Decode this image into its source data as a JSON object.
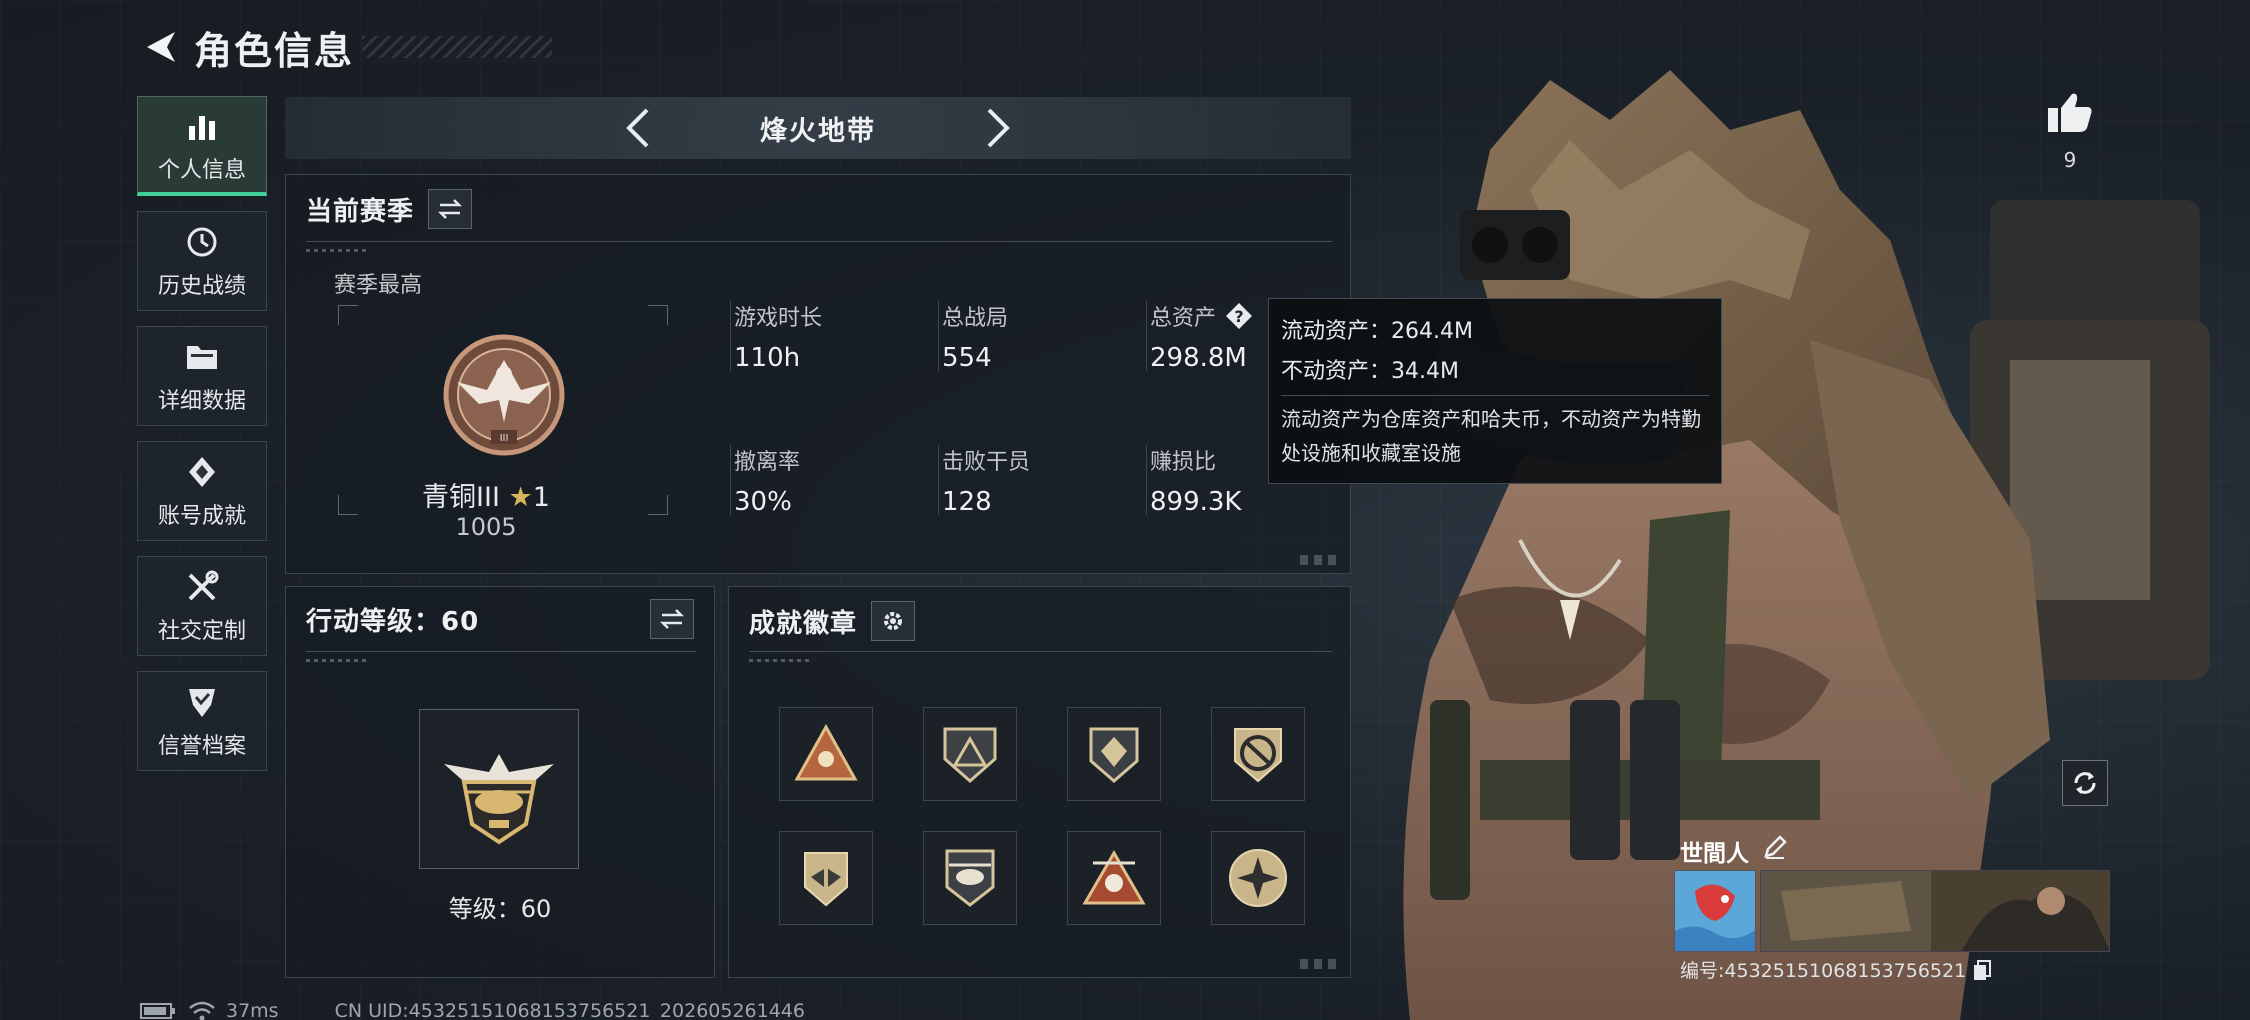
{
  "header": {
    "title": "角色信息"
  },
  "sidebar": {
    "items": [
      {
        "label": "个人信息",
        "icon": "bar-chart-icon",
        "active": true
      },
      {
        "label": "历史战绩",
        "icon": "history-clock-icon",
        "active": false
      },
      {
        "label": "详细数据",
        "icon": "folder-icon",
        "active": false
      },
      {
        "label": "账号成就",
        "icon": "achievement-diamond-icon",
        "active": false
      },
      {
        "label": "社交定制",
        "icon": "tools-icon",
        "active": false
      },
      {
        "label": "信誉档案",
        "icon": "shield-check-icon",
        "active": false
      }
    ]
  },
  "mode_selector": {
    "title": "烽火地带"
  },
  "season": {
    "title": "当前赛季",
    "best_label": "赛季最高",
    "rank_name": "青铜III",
    "rank_star_count": "1",
    "rank_score": "1005",
    "stats": [
      {
        "label": "游戏时长",
        "value": "110h"
      },
      {
        "label": "总战局",
        "value": "554"
      },
      {
        "label": "总资产",
        "value": "298.8M"
      },
      {
        "label": "撤离率",
        "value": "30%"
      },
      {
        "label": "击败干员",
        "value": "128"
      },
      {
        "label": "赚损比",
        "value": "899.3K"
      }
    ]
  },
  "asset_tooltip": {
    "liquid": "流动资产：264.4M",
    "fixed": "不动资产：34.4M",
    "description": "流动资产为仓库资产和哈夫币，不动资产为特勤处设施和收藏室设施"
  },
  "level": {
    "title": "行动等级：60",
    "level_label": "等级：60"
  },
  "badges": {
    "title": "成就徽章",
    "items": [
      {
        "icon": "triangle-emblem-icon"
      },
      {
        "icon": "shield-triangle-icon"
      },
      {
        "icon": "shield-gem-icon"
      },
      {
        "icon": "no-rifle-badge-icon"
      },
      {
        "icon": "winged-shield-icon"
      },
      {
        "icon": "helicopter-badge-icon"
      },
      {
        "icon": "skull-triangle-icon"
      },
      {
        "icon": "star-circle-badge-icon"
      }
    ]
  },
  "likes": {
    "count": "9"
  },
  "profile": {
    "name": "世間人",
    "player_id": "编号:45325151068153756521"
  },
  "footer": {
    "latency": "37ms",
    "uid": "CN UID:45325151068153756521_202605261446"
  },
  "colors": {
    "accent_green": "#3fd19a",
    "background": "#1b2128",
    "bronze": "#a8755a"
  }
}
